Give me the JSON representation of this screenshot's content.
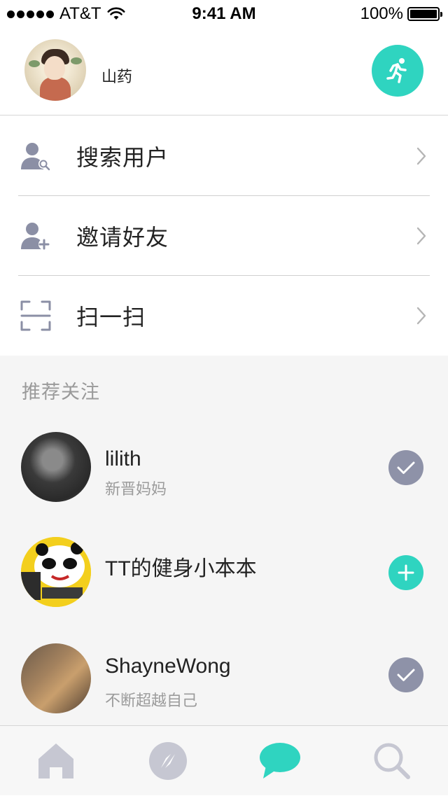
{
  "status_bar": {
    "carrier": "AT&T",
    "time": "9:41 AM",
    "battery": "100%"
  },
  "header": {
    "username": "山药",
    "avatar_icon": "user-avatar",
    "action_icon": "running-icon",
    "accent_color": "#2fd4c0"
  },
  "menu": {
    "items": [
      {
        "label": "搜索用户",
        "icon": "search-user-icon"
      },
      {
        "label": "邀请好友",
        "icon": "add-friend-icon"
      },
      {
        "label": "扫一扫",
        "icon": "scan-icon"
      }
    ]
  },
  "recommend": {
    "title": "推荐关注",
    "users": [
      {
        "name": "lilith",
        "bio": "新晋妈妈",
        "status": "followed"
      },
      {
        "name": "TT的健身小本本",
        "bio": "",
        "status": "follow"
      },
      {
        "name": "ShayneWong",
        "bio": "不断超越自己",
        "status": "followed"
      }
    ]
  },
  "tab_bar": {
    "tabs": [
      {
        "icon": "home-icon",
        "active": false
      },
      {
        "icon": "compass-icon",
        "active": false
      },
      {
        "icon": "chat-icon",
        "active": true
      },
      {
        "icon": "search-icon",
        "active": false
      }
    ],
    "inactive_color": "#c6c7d2",
    "active_color": "#2fd4c0"
  }
}
